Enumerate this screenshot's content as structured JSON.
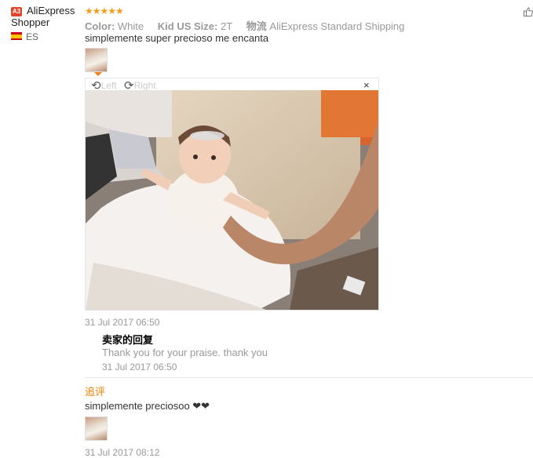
{
  "user": {
    "badge": "A3",
    "name": "AliExpress Shopper",
    "country": "ES"
  },
  "review": {
    "stars": "★★★★★",
    "color_label": "Color:",
    "color_value": "White",
    "size_label": "Kid US Size:",
    "size_value": "2T",
    "shipping_label": "物流",
    "shipping_value": "AliExpress Standard Shipping",
    "text": "simplemente super precioso me encanta",
    "date": "31 Jul 2017 06:50"
  },
  "viewer": {
    "left_label": "Left",
    "right_label": "Right",
    "close": "×"
  },
  "seller_reply": {
    "title": "卖家的回复",
    "text": "Thank you for your praise. thank you",
    "date": "31 Jul 2017 06:50"
  },
  "additional": {
    "title": "追评",
    "text": "simplemente preciosoo ❤❤",
    "date": "31 Jul 2017 08:12"
  },
  "colors": {
    "star": "#f59c1a",
    "accent": "#f08200",
    "badge": "#e0452b"
  }
}
